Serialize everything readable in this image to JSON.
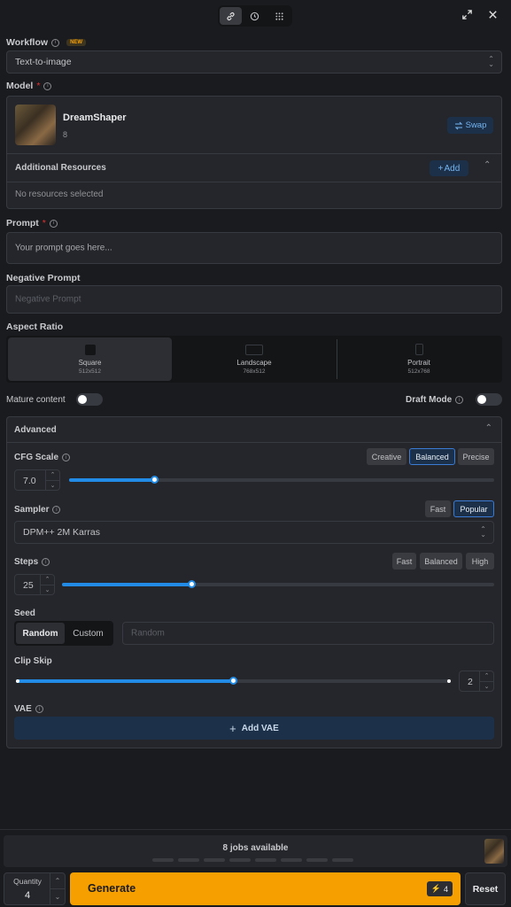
{
  "workflow": {
    "label": "Workflow",
    "badge": "NEW",
    "value": "Text-to-image"
  },
  "model": {
    "label": "Model",
    "required": "*",
    "name": "DreamShaper",
    "version": "8",
    "swap_label": "Swap"
  },
  "resources": {
    "title": "Additional Resources",
    "add_label": "Add",
    "empty_text": "No resources selected"
  },
  "prompt": {
    "label": "Prompt",
    "required": "*",
    "placeholder": "Your prompt goes here..."
  },
  "negative": {
    "label": "Negative Prompt",
    "placeholder": "Negative Prompt"
  },
  "aspect": {
    "label": "Aspect Ratio",
    "options": [
      {
        "name": "Square",
        "size": "512x512"
      },
      {
        "name": "Landscape",
        "size": "768x512"
      },
      {
        "name": "Portrait",
        "size": "512x768"
      }
    ]
  },
  "mature": {
    "label": "Mature content",
    "on": false
  },
  "draft": {
    "label": "Draft Mode",
    "on": false
  },
  "advanced": {
    "title": "Advanced",
    "cfg": {
      "label": "CFG Scale",
      "value": "7.0",
      "level": 0.2,
      "presets": [
        "Creative",
        "Balanced",
        "Precise"
      ],
      "selected": "Balanced"
    },
    "sampler": {
      "label": "Sampler",
      "value": "DPM++ 2M Karras",
      "presets": [
        "Fast",
        "Popular"
      ],
      "selected": "Popular"
    },
    "steps": {
      "label": "Steps",
      "value": "25",
      "level": 0.3,
      "presets": [
        "Fast",
        "Balanced",
        "High"
      ]
    },
    "seed": {
      "label": "Seed",
      "modes": [
        "Random",
        "Custom"
      ],
      "selected": "Random",
      "placeholder": "Random"
    },
    "clip": {
      "label": "Clip Skip",
      "value": "2",
      "level": 0.5
    },
    "vae": {
      "label": "VAE",
      "add_label": "Add VAE"
    }
  },
  "footer": {
    "jobs_text": "8 jobs available",
    "quantity_label": "Quantity",
    "quantity_value": "4",
    "generate_label": "Generate",
    "cost": "4",
    "reset_label": "Reset"
  },
  "colors": {
    "accent": "#228be6",
    "generate": "#f59f00",
    "bg": "#1a1b1e"
  }
}
